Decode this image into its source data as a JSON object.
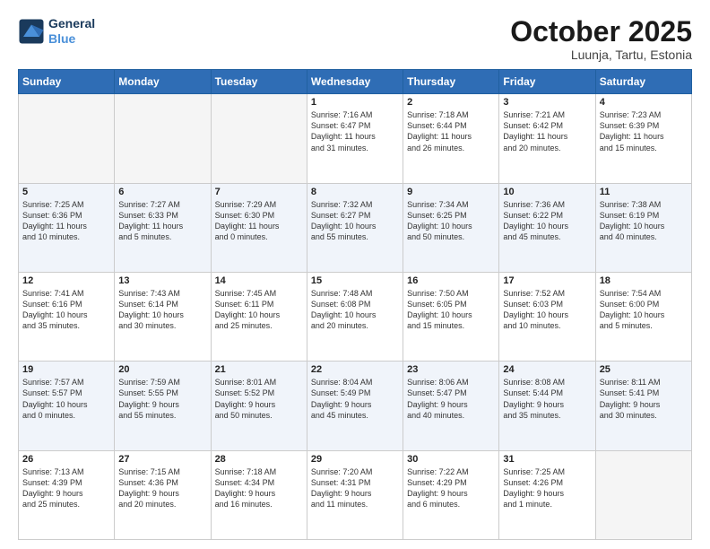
{
  "header": {
    "logo_line1": "General",
    "logo_line2": "Blue",
    "month": "October 2025",
    "location": "Luunja, Tartu, Estonia"
  },
  "days_of_week": [
    "Sunday",
    "Monday",
    "Tuesday",
    "Wednesday",
    "Thursday",
    "Friday",
    "Saturday"
  ],
  "weeks": [
    [
      {
        "day": "",
        "info": ""
      },
      {
        "day": "",
        "info": ""
      },
      {
        "day": "",
        "info": ""
      },
      {
        "day": "1",
        "info": "Sunrise: 7:16 AM\nSunset: 6:47 PM\nDaylight: 11 hours\nand 31 minutes."
      },
      {
        "day": "2",
        "info": "Sunrise: 7:18 AM\nSunset: 6:44 PM\nDaylight: 11 hours\nand 26 minutes."
      },
      {
        "day": "3",
        "info": "Sunrise: 7:21 AM\nSunset: 6:42 PM\nDaylight: 11 hours\nand 20 minutes."
      },
      {
        "day": "4",
        "info": "Sunrise: 7:23 AM\nSunset: 6:39 PM\nDaylight: 11 hours\nand 15 minutes."
      }
    ],
    [
      {
        "day": "5",
        "info": "Sunrise: 7:25 AM\nSunset: 6:36 PM\nDaylight: 11 hours\nand 10 minutes."
      },
      {
        "day": "6",
        "info": "Sunrise: 7:27 AM\nSunset: 6:33 PM\nDaylight: 11 hours\nand 5 minutes."
      },
      {
        "day": "7",
        "info": "Sunrise: 7:29 AM\nSunset: 6:30 PM\nDaylight: 11 hours\nand 0 minutes."
      },
      {
        "day": "8",
        "info": "Sunrise: 7:32 AM\nSunset: 6:27 PM\nDaylight: 10 hours\nand 55 minutes."
      },
      {
        "day": "9",
        "info": "Sunrise: 7:34 AM\nSunset: 6:25 PM\nDaylight: 10 hours\nand 50 minutes."
      },
      {
        "day": "10",
        "info": "Sunrise: 7:36 AM\nSunset: 6:22 PM\nDaylight: 10 hours\nand 45 minutes."
      },
      {
        "day": "11",
        "info": "Sunrise: 7:38 AM\nSunset: 6:19 PM\nDaylight: 10 hours\nand 40 minutes."
      }
    ],
    [
      {
        "day": "12",
        "info": "Sunrise: 7:41 AM\nSunset: 6:16 PM\nDaylight: 10 hours\nand 35 minutes."
      },
      {
        "day": "13",
        "info": "Sunrise: 7:43 AM\nSunset: 6:14 PM\nDaylight: 10 hours\nand 30 minutes."
      },
      {
        "day": "14",
        "info": "Sunrise: 7:45 AM\nSunset: 6:11 PM\nDaylight: 10 hours\nand 25 minutes."
      },
      {
        "day": "15",
        "info": "Sunrise: 7:48 AM\nSunset: 6:08 PM\nDaylight: 10 hours\nand 20 minutes."
      },
      {
        "day": "16",
        "info": "Sunrise: 7:50 AM\nSunset: 6:05 PM\nDaylight: 10 hours\nand 15 minutes."
      },
      {
        "day": "17",
        "info": "Sunrise: 7:52 AM\nSunset: 6:03 PM\nDaylight: 10 hours\nand 10 minutes."
      },
      {
        "day": "18",
        "info": "Sunrise: 7:54 AM\nSunset: 6:00 PM\nDaylight: 10 hours\nand 5 minutes."
      }
    ],
    [
      {
        "day": "19",
        "info": "Sunrise: 7:57 AM\nSunset: 5:57 PM\nDaylight: 10 hours\nand 0 minutes."
      },
      {
        "day": "20",
        "info": "Sunrise: 7:59 AM\nSunset: 5:55 PM\nDaylight: 9 hours\nand 55 minutes."
      },
      {
        "day": "21",
        "info": "Sunrise: 8:01 AM\nSunset: 5:52 PM\nDaylight: 9 hours\nand 50 minutes."
      },
      {
        "day": "22",
        "info": "Sunrise: 8:04 AM\nSunset: 5:49 PM\nDaylight: 9 hours\nand 45 minutes."
      },
      {
        "day": "23",
        "info": "Sunrise: 8:06 AM\nSunset: 5:47 PM\nDaylight: 9 hours\nand 40 minutes."
      },
      {
        "day": "24",
        "info": "Sunrise: 8:08 AM\nSunset: 5:44 PM\nDaylight: 9 hours\nand 35 minutes."
      },
      {
        "day": "25",
        "info": "Sunrise: 8:11 AM\nSunset: 5:41 PM\nDaylight: 9 hours\nand 30 minutes."
      }
    ],
    [
      {
        "day": "26",
        "info": "Sunrise: 7:13 AM\nSunset: 4:39 PM\nDaylight: 9 hours\nand 25 minutes."
      },
      {
        "day": "27",
        "info": "Sunrise: 7:15 AM\nSunset: 4:36 PM\nDaylight: 9 hours\nand 20 minutes."
      },
      {
        "day": "28",
        "info": "Sunrise: 7:18 AM\nSunset: 4:34 PM\nDaylight: 9 hours\nand 16 minutes."
      },
      {
        "day": "29",
        "info": "Sunrise: 7:20 AM\nSunset: 4:31 PM\nDaylight: 9 hours\nand 11 minutes."
      },
      {
        "day": "30",
        "info": "Sunrise: 7:22 AM\nSunset: 4:29 PM\nDaylight: 9 hours\nand 6 minutes."
      },
      {
        "day": "31",
        "info": "Sunrise: 7:25 AM\nSunset: 4:26 PM\nDaylight: 9 hours\nand 1 minute."
      },
      {
        "day": "",
        "info": ""
      }
    ]
  ]
}
